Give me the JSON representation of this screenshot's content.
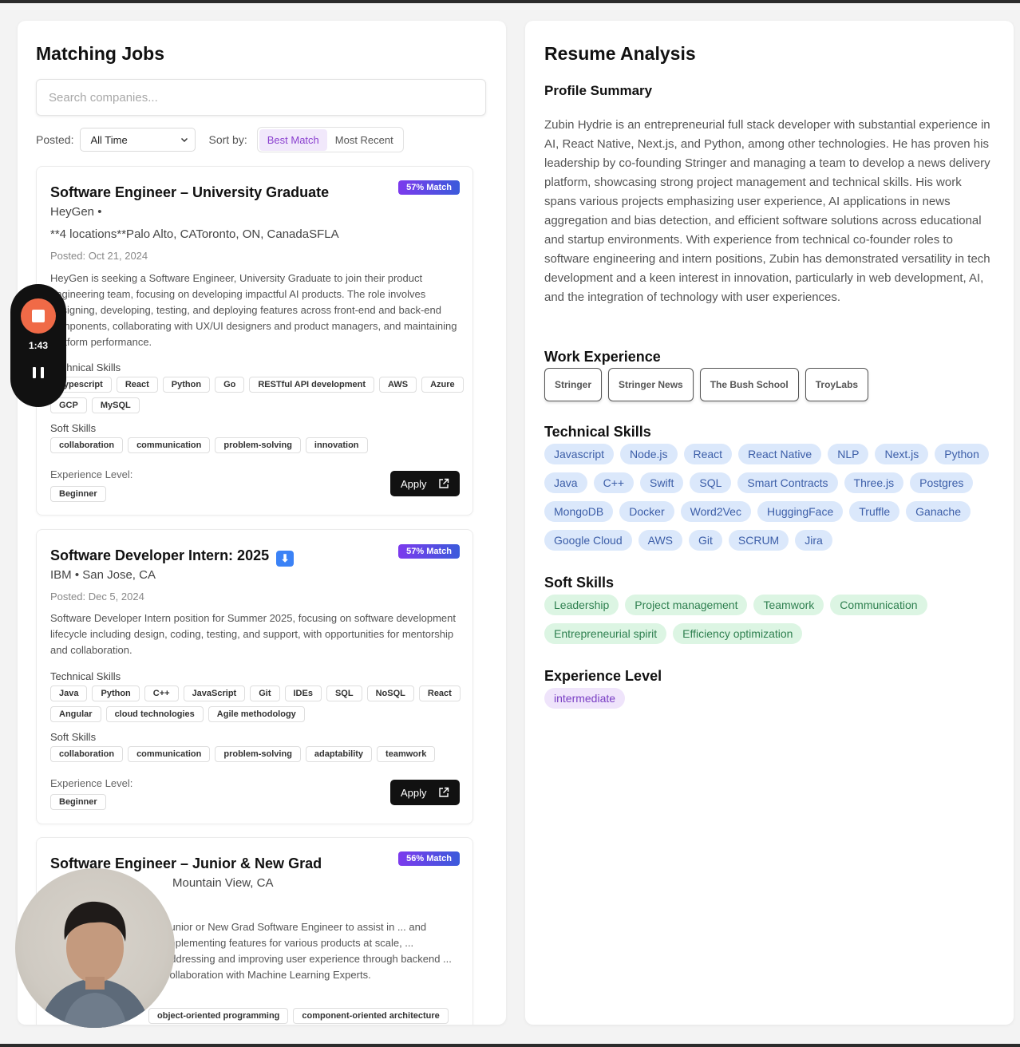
{
  "jobs_panel": {
    "title": "Matching Jobs",
    "search_placeholder": "Search companies...",
    "posted_label": "Posted:",
    "posted_value": "All Time",
    "sort_label": "Sort by:",
    "sort_options": [
      "Best Match",
      "Most Recent"
    ],
    "sort_selected": "Best Match",
    "jobs": [
      {
        "title": "Software Engineer – University Graduate",
        "match": "57% Match",
        "company": "HeyGen •",
        "locations": "**4 locations**Palo Alto, CAToronto, ON, CanadaSFLA",
        "posted": "Posted: Oct 21, 2024",
        "description": "HeyGen is seeking a Software Engineer, University Graduate to join their product engineering team, focusing on developing impactful AI products. The role involves designing, developing, testing, and deploying features across front-end and back-end components, collaborating with UX/UI designers and product managers, and maintaining platform performance.",
        "tech_label": "Technical Skills",
        "tech": [
          "Typescript",
          "React",
          "Python",
          "Go",
          "RESTful API development",
          "AWS",
          "Azure",
          "GCP",
          "MySQL"
        ],
        "soft_label": "Soft Skills",
        "soft": [
          "collaboration",
          "communication",
          "problem-solving",
          "innovation"
        ],
        "level_label": "Experience Level:",
        "level": "Beginner",
        "apply": "Apply"
      },
      {
        "title": "Software Developer Intern: 2025",
        "match": "57% Match",
        "company": "IBM • San Jose, CA",
        "posted": "Posted: Dec 5, 2024",
        "description": "Software Developer Intern position for Summer 2025, focusing on software development lifecycle including design, coding, testing, and support, with opportunities for mentorship and collaboration.",
        "tech_label": "Technical Skills",
        "tech": [
          "Java",
          "Python",
          "C++",
          "JavaScript",
          "Git",
          "IDEs",
          "SQL",
          "NoSQL",
          "React",
          "Angular",
          "cloud technologies",
          "Agile methodology"
        ],
        "soft_label": "Soft Skills",
        "soft": [
          "collaboration",
          "communication",
          "problem-solving",
          "adaptability",
          "teamwork"
        ],
        "level_label": "Experience Level:",
        "level": "Beginner",
        "apply": "Apply"
      },
      {
        "title": "Software Engineer – Junior & New Grad",
        "match": "56% Match",
        "company": "Mountain View, CA",
        "description": "Junior or New Grad Software Engineer to assist in ... and implementing features for various products at scale, ... addressing and improving user experience through backend ... collaboration with Machine Learning Experts.",
        "tech": [
          "object-oriented programming",
          "component-oriented architecture"
        ]
      }
    ]
  },
  "analysis_panel": {
    "title": "Resume Analysis",
    "summary_heading": "Profile Summary",
    "summary": "Zubin Hydrie is an entrepreneurial full stack developer with substantial experience in AI, React Native, Next.js, and Python, among other technologies. He has proven his leadership by co-founding Stringer and managing a team to develop a news delivery platform, showcasing strong project management and technical skills. His work spans various projects emphasizing user experience, AI applications in news aggregation and bias detection, and efficient software solutions across educational and startup environments. With experience from technical co-founder roles to software engineering and intern positions, Zubin has demonstrated versatility in tech development and a keen interest in innovation, particularly in web development, AI, and the integration of technology with user experiences.",
    "work_heading": "Work Experience",
    "work": [
      "Stringer",
      "Stringer News",
      "The Bush School",
      "TroyLabs"
    ],
    "tech_heading": "Technical Skills",
    "tech": [
      "Javascript",
      "Node.js",
      "React",
      "React Native",
      "NLP",
      "Next.js",
      "Python",
      "Java",
      "C++",
      "Swift",
      "SQL",
      "Smart Contracts",
      "Three.js",
      "Postgres",
      "MongoDB",
      "Docker",
      "Word2Vec",
      "HuggingFace",
      "Truffle",
      "Ganache",
      "Google Cloud",
      "AWS",
      "Git",
      "SCRUM",
      "Jira"
    ],
    "soft_heading": "Soft Skills",
    "soft": [
      "Leadership",
      "Project management",
      "Teamwork",
      "Communication",
      "Entrepreneurial spirit",
      "Efficiency optimization"
    ],
    "level_heading": "Experience Level",
    "level": "intermediate"
  },
  "recorder": {
    "time": "1:43"
  },
  "colors": {
    "accent": "#8a3fcf",
    "match_start": "#7c3aed",
    "match_end": "#3b5bdb",
    "record": "#f06a47"
  }
}
